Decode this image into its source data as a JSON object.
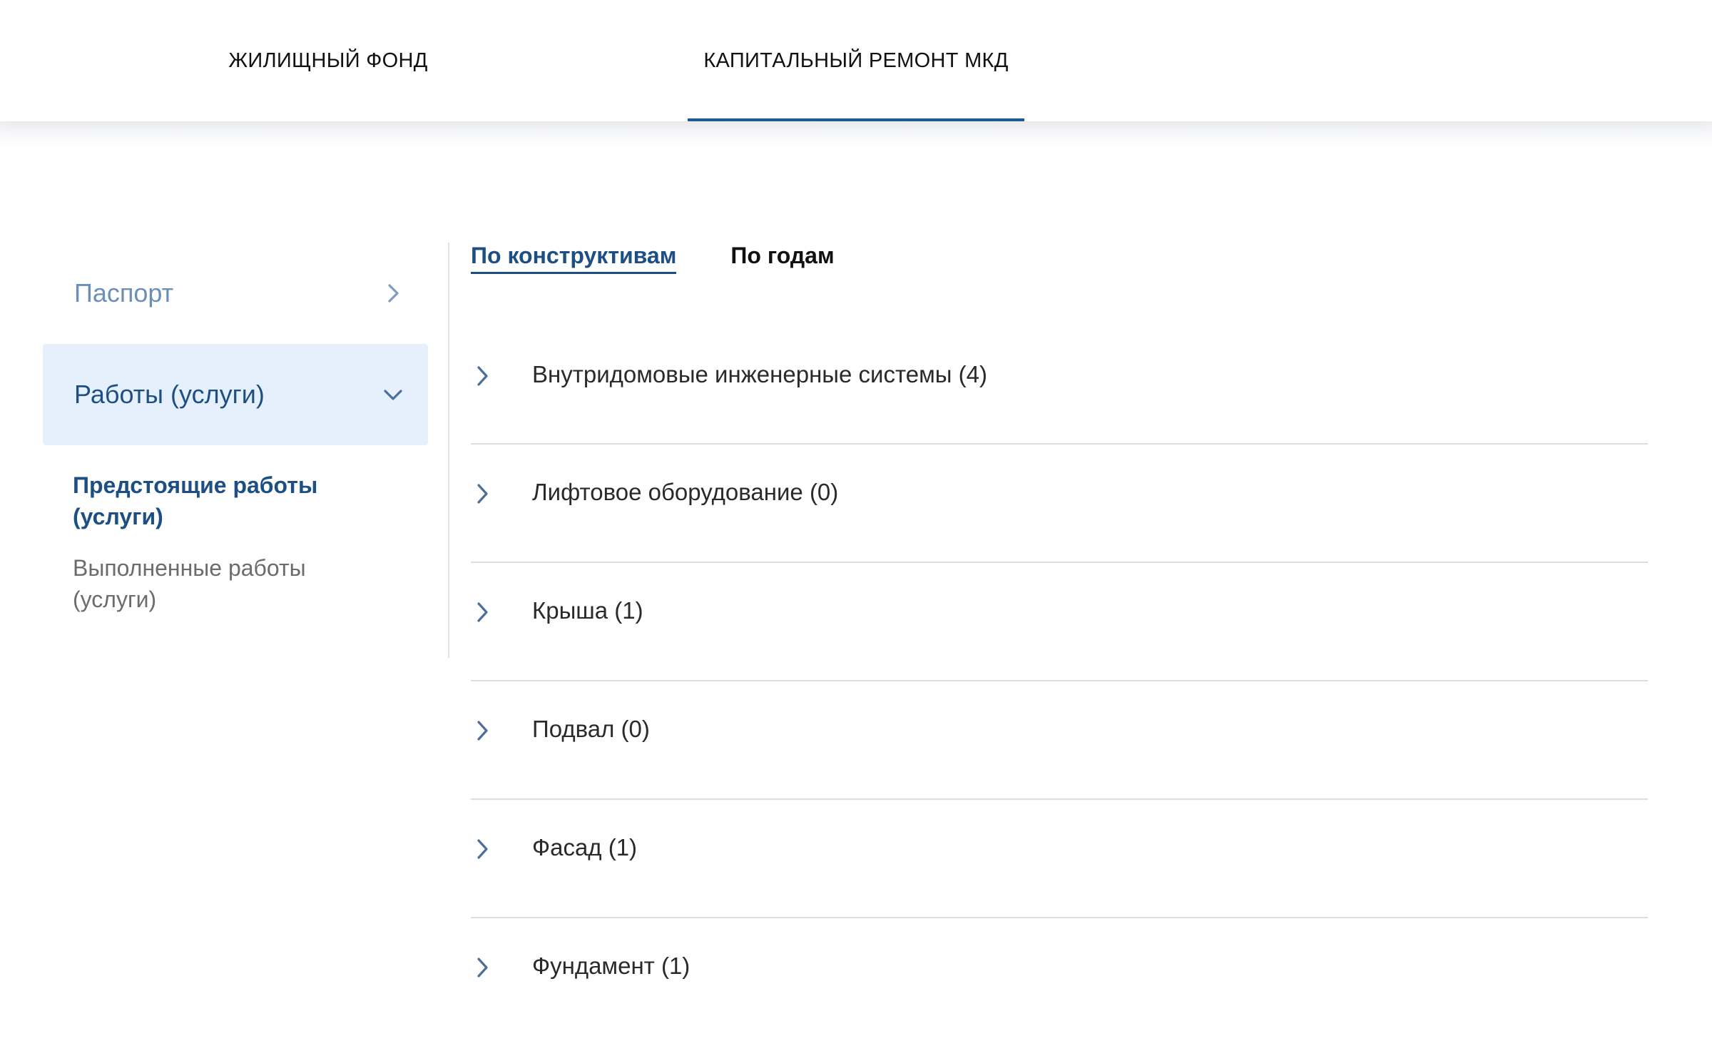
{
  "top_tabs": [
    {
      "label": "ЖИЛИЩНЫЙ ФОНД",
      "active": false
    },
    {
      "label": "КАПИТАЛЬНЫЙ РЕМОНТ МКД",
      "active": true
    }
  ],
  "sidebar": {
    "items": [
      {
        "label": "Паспорт",
        "state": "collapsed"
      },
      {
        "label": "Работы (услуги)",
        "state": "expanded"
      }
    ],
    "sub_items": [
      {
        "label": "Предстоящие работы (услуги)",
        "active": true
      },
      {
        "label": "Выполненные работы (услуги)",
        "active": false
      }
    ]
  },
  "main": {
    "view_tabs": [
      {
        "label": "По конструктивам",
        "active": true
      },
      {
        "label": "По годам",
        "active": false
      }
    ],
    "categories": [
      {
        "label": "Внутридомовые инженерные системы (4)"
      },
      {
        "label": "Лифтовое оборудование (0)"
      },
      {
        "label": "Крыша (1)"
      },
      {
        "label": "Подвал (0)"
      },
      {
        "label": "Фасад (1)"
      },
      {
        "label": "Фундамент (1)"
      }
    ]
  },
  "colors": {
    "accent": "#1e5a96",
    "active_text": "#1e4f84",
    "selected_bg": "#e5f0fc",
    "muted_link": "#6a8fb8",
    "divider": "#dedede"
  },
  "icons": {
    "collapsed": "chevron-right-icon",
    "expanded": "chevron-down-icon"
  }
}
